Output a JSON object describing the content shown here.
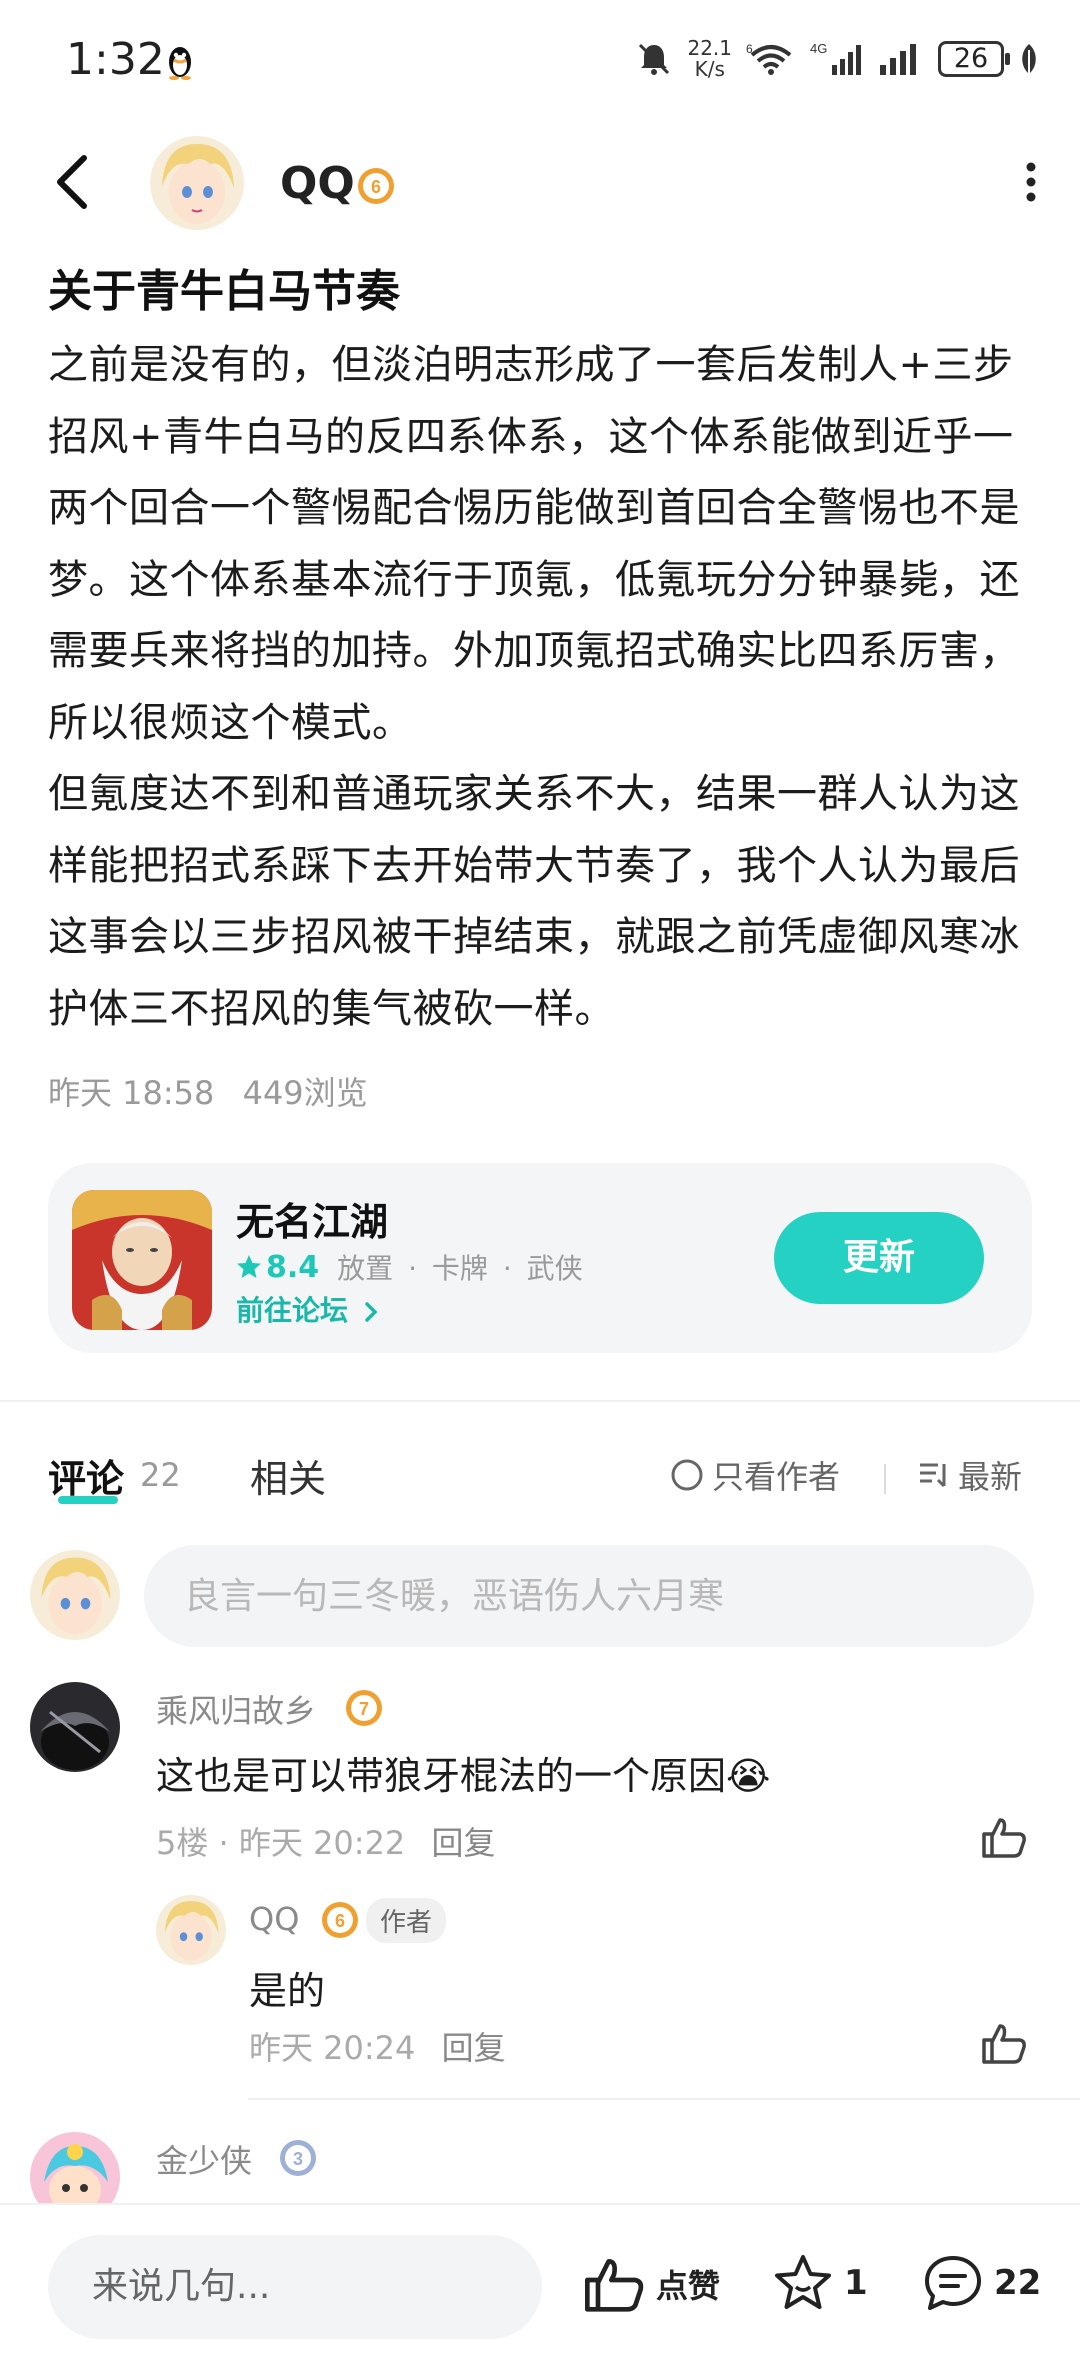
{
  "status_bar": {
    "time": "1:32",
    "speed_value": "22.1",
    "speed_unit": "K/s",
    "battery": "26",
    "icons": [
      "qq-penguin-icon",
      "mute-bell-icon",
      "wifi-6-icon",
      "4g-signal-icon",
      "signal-icon",
      "battery-icon",
      "leaf-icon"
    ]
  },
  "header": {
    "author_name": "QQ",
    "level_badge": "6"
  },
  "post": {
    "title": "关于青牛白马节奏",
    "paragraphs": [
      "之前是没有的，但淡泊明志形成了一套后发制人+三步招风+青牛白马的反四系体系，这个体系能做到近乎一两个回合一个警惕配合惕历能做到首回合全警惕也不是梦。这个体系基本流行于顶氪，低氪玩分分钟暴毙，还需要兵来将挡的加持。外加顶氪招式确实比四系厉害，所以很烦这个模式。",
      "但氪度达不到和普通玩家关系不大，结果一群人认为这样能把招式系踩下去开始带大节奏了，我个人认为最后这事会以三步招风被干掉结束，就跟之前凭虚御风寒冰护体三不招风的集气被砍一样。"
    ],
    "time": "昨天 18:58",
    "views": "449浏览"
  },
  "game_card": {
    "name": "无名江湖",
    "rating": "8.4",
    "tags": [
      "放置",
      "·",
      "卡牌",
      "·",
      "武侠"
    ],
    "forum_link": "前往论坛",
    "button": "更新"
  },
  "tabs": {
    "comments_label": "评论",
    "comments_count": "22",
    "related_label": "相关",
    "author_only": "只看作者",
    "sort": "最新"
  },
  "comment_input": {
    "placeholder": "良言一句三冬暖，恶语伤人六月寒"
  },
  "comments": [
    {
      "name": "乘风归故乡",
      "level": "7",
      "text": "这也是可以带狼牙棍法的一个原因",
      "emoji": "😭",
      "floor": "5楼",
      "time": "昨天 20:22",
      "reply": "回复",
      "reply_item": {
        "name": "QQ",
        "level": "6",
        "author_tag": "作者",
        "text": "是的",
        "time": "昨天 20:24",
        "reply": "回复"
      }
    },
    {
      "name": "金少侠",
      "level": "3"
    }
  ],
  "bottom_bar": {
    "input_label": "来说几句...",
    "like_label": "点赞",
    "fav_count": "1",
    "comment_count": "22"
  },
  "colors": {
    "accent": "#25d1c3",
    "level_orange": "#f0a030",
    "level_blue": "#9fb0d6"
  }
}
